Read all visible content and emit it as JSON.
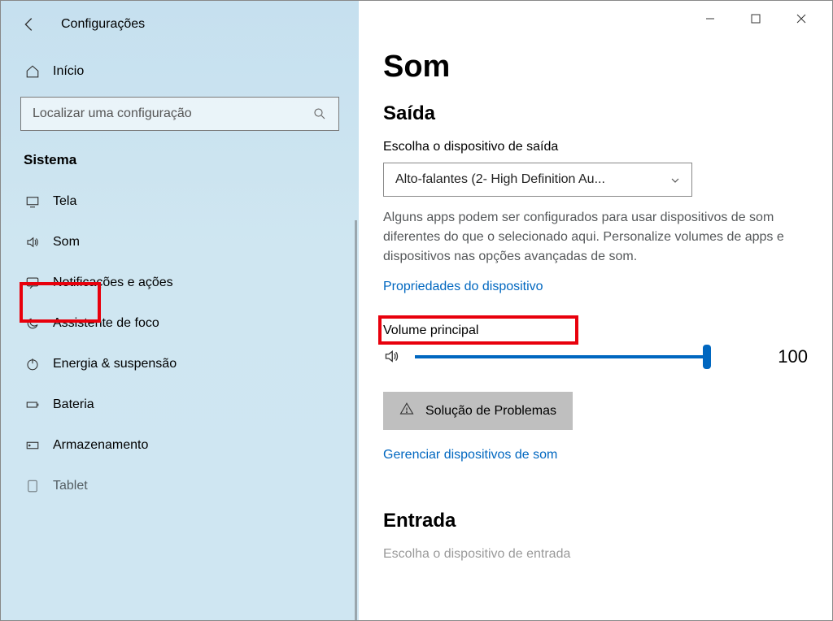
{
  "header": {
    "window_title": "Configurações"
  },
  "sidebar": {
    "home": "Início",
    "search_placeholder": "Localizar uma configuração",
    "category": "Sistema",
    "items": [
      {
        "icon": "monitor-icon",
        "label": "Tela"
      },
      {
        "icon": "speaker-icon",
        "label": "Som",
        "selected": true
      },
      {
        "icon": "chat-icon",
        "label": "Notificações e ações"
      },
      {
        "icon": "moon-icon",
        "label": "Assistente de foco"
      },
      {
        "icon": "power-icon",
        "label": "Energia & suspensão"
      },
      {
        "icon": "battery-icon",
        "label": "Bateria"
      },
      {
        "icon": "storage-icon",
        "label": "Armazenamento"
      },
      {
        "icon": "tablet-icon",
        "label": "Tablet"
      }
    ]
  },
  "main": {
    "title": "Som",
    "output": {
      "heading": "Saída",
      "choose_label": "Escolha o dispositivo de saída",
      "selected_device": "Alto-falantes (2- High Definition Au...",
      "hint": "Alguns apps podem ser configurados para usar dispositivos de som diferentes do que o selecionado aqui. Personalize volumes de apps e dispositivos nas opções avançadas de som.",
      "device_props_link": "Propriedades do dispositivo",
      "master_volume_label": "Volume principal",
      "master_volume_value": "100",
      "troubleshoot": "Solução de Problemas",
      "manage_link": "Gerenciar dispositivos de som"
    },
    "input": {
      "heading": "Entrada",
      "choose_label_partial": "Escolha o dispositivo de entrada"
    }
  }
}
